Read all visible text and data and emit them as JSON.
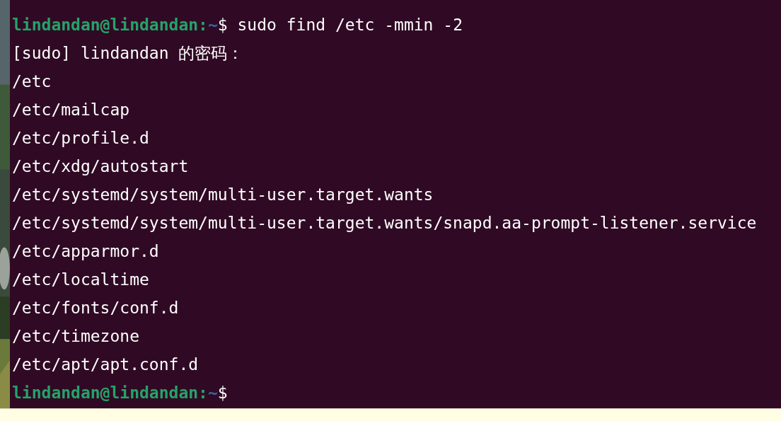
{
  "terminal": {
    "lines": [
      {
        "kind": "prompt",
        "user_host": "lindandan@lindandan:",
        "path": "~",
        "symbol": "$",
        "command": "sudo find /etc -mmin -2"
      },
      {
        "kind": "output",
        "text": "[sudo] lindandan 的密码："
      },
      {
        "kind": "output",
        "text": "/etc"
      },
      {
        "kind": "output",
        "text": "/etc/mailcap"
      },
      {
        "kind": "output",
        "text": "/etc/profile.d"
      },
      {
        "kind": "output",
        "text": "/etc/xdg/autostart"
      },
      {
        "kind": "output",
        "text": "/etc/systemd/system/multi-user.target.wants"
      },
      {
        "kind": "output",
        "text": "/etc/systemd/system/multi-user.target.wants/snapd.aa-prompt-listener.service"
      },
      {
        "kind": "output",
        "text": "/etc/apparmor.d"
      },
      {
        "kind": "output",
        "text": "/etc/localtime"
      },
      {
        "kind": "output",
        "text": "/etc/fonts/conf.d"
      },
      {
        "kind": "output",
        "text": "/etc/timezone"
      },
      {
        "kind": "output",
        "text": "/etc/apt/apt.conf.d"
      },
      {
        "kind": "prompt",
        "user_host": "lindandan@lindandan:",
        "path": "~",
        "symbol": "$"
      }
    ]
  }
}
